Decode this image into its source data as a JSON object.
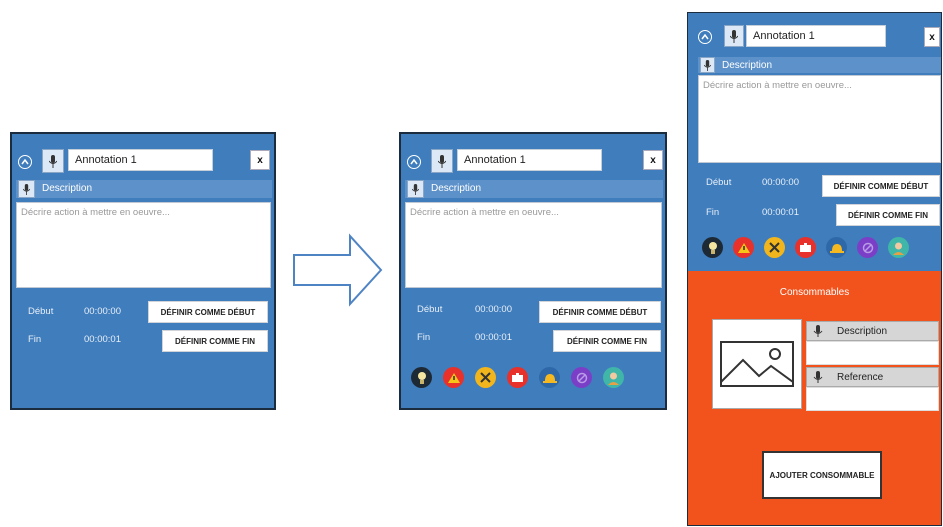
{
  "annotation_title": "Annotation 1",
  "close_label": "x",
  "description_label": "Description",
  "textarea_placeholder": "Décrire action à mettre en oeuvre...",
  "start_label": "Début",
  "start_value": "00:00:00",
  "end_label": "Fin",
  "end_value": "00:00:01",
  "set_start_button": "DÉFINIR COMME DÉBUT",
  "set_end_button": "DÉFINIR COMME FIN",
  "consumables": {
    "title": "Consommables",
    "description_label": "Description",
    "reference_label": "Reference",
    "add_button": "AJOUTER CONSOMMABLE"
  },
  "icons": [
    "lightbulb-icon",
    "warning-icon",
    "tools-icon",
    "toolbox-icon",
    "helmet-icon",
    "forbidden-icon",
    "person-icon"
  ],
  "colors": {
    "panel": "#3f7dbd",
    "orange": "#f2521c"
  }
}
